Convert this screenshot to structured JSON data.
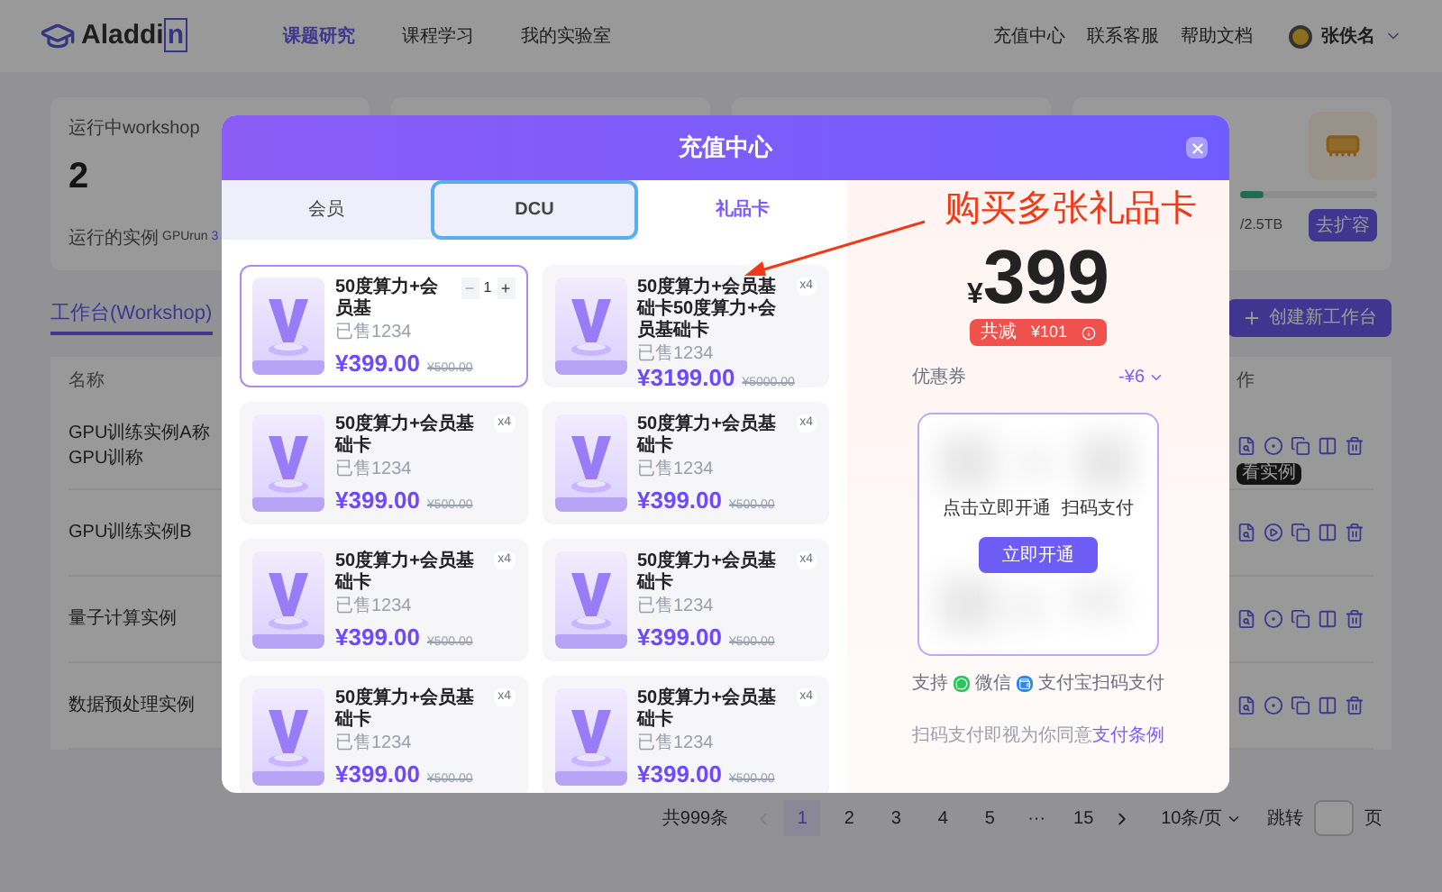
{
  "header": {
    "logo": {
      "text": "Aladdi",
      "mark": "n"
    },
    "nav": [
      {
        "label": "课题研究",
        "selected": true
      },
      {
        "label": "课程学习",
        "selected": false
      },
      {
        "label": "我的实验室",
        "selected": false
      }
    ],
    "links": [
      "充值中心",
      "联系客服",
      "帮助文档"
    ],
    "user": "张佚名"
  },
  "stats": {
    "running": {
      "title": "运行中workshop",
      "value": "2",
      "footer_label": "运行的实例",
      "footer_tag": "GPUrun",
      "footer_count": "3"
    },
    "storage": {
      "level": 0.17,
      "reading": "/2.5TB",
      "button": "去扩容"
    }
  },
  "workspace": {
    "tabs": [
      {
        "label": "工作台(Workshop)",
        "selected": true
      }
    ],
    "create_button": "创建新工作台"
  },
  "table": {
    "columns": [
      "名称",
      "作"
    ],
    "rows": [
      {
        "name": "GPU训练实例A称GPU训称",
        "running": true,
        "tooltip": "看实例"
      },
      {
        "name": "GPU训练实例B",
        "running": false
      },
      {
        "name": "量子计算实例",
        "running": true
      },
      {
        "name": "数据预处理实例",
        "running": true
      }
    ]
  },
  "pagination": {
    "total": "共999条",
    "pages": [
      {
        "label": "1",
        "selected": true
      },
      {
        "label": "2",
        "selected": false
      },
      {
        "label": "3",
        "selected": false
      },
      {
        "label": "4",
        "selected": false
      },
      {
        "label": "5",
        "selected": false
      },
      {
        "label": "···",
        "selected": false
      },
      {
        "label": "15",
        "selected": false
      }
    ],
    "page_size": "10条/页",
    "jump_label": "跳转",
    "page_unit": "页"
  },
  "dialog": {
    "title": "充值中心",
    "tabs": [
      {
        "label": "会员",
        "selected": false,
        "focused": false
      },
      {
        "label": "DCU",
        "selected": false,
        "focused": true
      },
      {
        "label": "礼品卡",
        "selected": true,
        "focused": false
      }
    ],
    "cards": [
      {
        "title": "50度算力+会员基",
        "sold": "已售1234",
        "price": "¥399.00",
        "original_price": "¥500.00",
        "selected": true,
        "quantity": {
          "minus": "−",
          "value": "1",
          "plus": "+"
        }
      },
      {
        "title": "50度算力+会员基础卡50度算力+会员基础卡",
        "sold": "已售1234",
        "price": "¥3199.00",
        "original_price": "¥5000.00",
        "selected": false,
        "badge": "x4"
      },
      {
        "title": "50度算力+会员基础卡",
        "sold": "已售1234",
        "price": "¥399.00",
        "original_price": "¥500.00",
        "selected": false,
        "badge": "x4"
      },
      {
        "title": "50度算力+会员基础卡",
        "sold": "已售1234",
        "price": "¥399.00",
        "original_price": "¥500.00",
        "selected": false,
        "badge": "x4"
      },
      {
        "title": "50度算力+会员基础卡",
        "sold": "已售1234",
        "price": "¥399.00",
        "original_price": "¥500.00",
        "selected": false,
        "badge": "x4"
      },
      {
        "title": "50度算力+会员基础卡",
        "sold": "已售1234",
        "price": "¥399.00",
        "original_price": "¥500.00",
        "selected": false,
        "badge": "x4"
      },
      {
        "title": "50度算力+会员基础卡",
        "sold": "已售1234",
        "price": "¥399.00",
        "original_price": "¥500.00",
        "selected": false,
        "badge": "x4"
      },
      {
        "title": "50度算力+会员基础卡",
        "sold": "已售1234",
        "price": "¥399.00",
        "original_price": "¥500.00",
        "selected": false,
        "badge": "x4"
      }
    ],
    "annotation": "购买多张礼品卡",
    "summary": {
      "currency": "¥",
      "amount": "399",
      "discount_label": "共减",
      "discount": "¥101",
      "coupon_label": "优惠券",
      "coupon_value": "-¥6"
    },
    "qr": {
      "hint": "点击立即开通  扫码支付",
      "button": "立即开通"
    },
    "support": {
      "prefix": "支持",
      "wechat": "微信",
      "alipay": "支付宝扫码支付"
    },
    "terms": {
      "text": "扫码支付即视为你同意",
      "link": "支付条例"
    }
  }
}
